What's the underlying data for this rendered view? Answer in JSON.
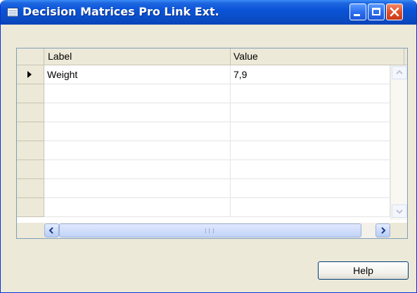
{
  "window": {
    "title": "Decision Matrices Pro Link Ext.",
    "icon": "form-icon",
    "controls": [
      "minimize-icon",
      "maximize-icon",
      "close-icon"
    ]
  },
  "grid": {
    "columns": [
      "Label",
      "Value"
    ],
    "rows": [
      {
        "label": "Weight",
        "value": "7,9",
        "selected": true
      },
      {
        "label": "",
        "value": ""
      },
      {
        "label": "",
        "value": ""
      },
      {
        "label": "",
        "value": ""
      },
      {
        "label": "",
        "value": ""
      },
      {
        "label": "",
        "value": ""
      },
      {
        "label": "",
        "value": ""
      },
      {
        "label": "",
        "value": ""
      }
    ]
  },
  "buttons": {
    "help": "Help"
  },
  "colors": {
    "title_bar": "#0a53d8",
    "window_bg": "#ece9d8",
    "close_button": "#e0502a"
  }
}
